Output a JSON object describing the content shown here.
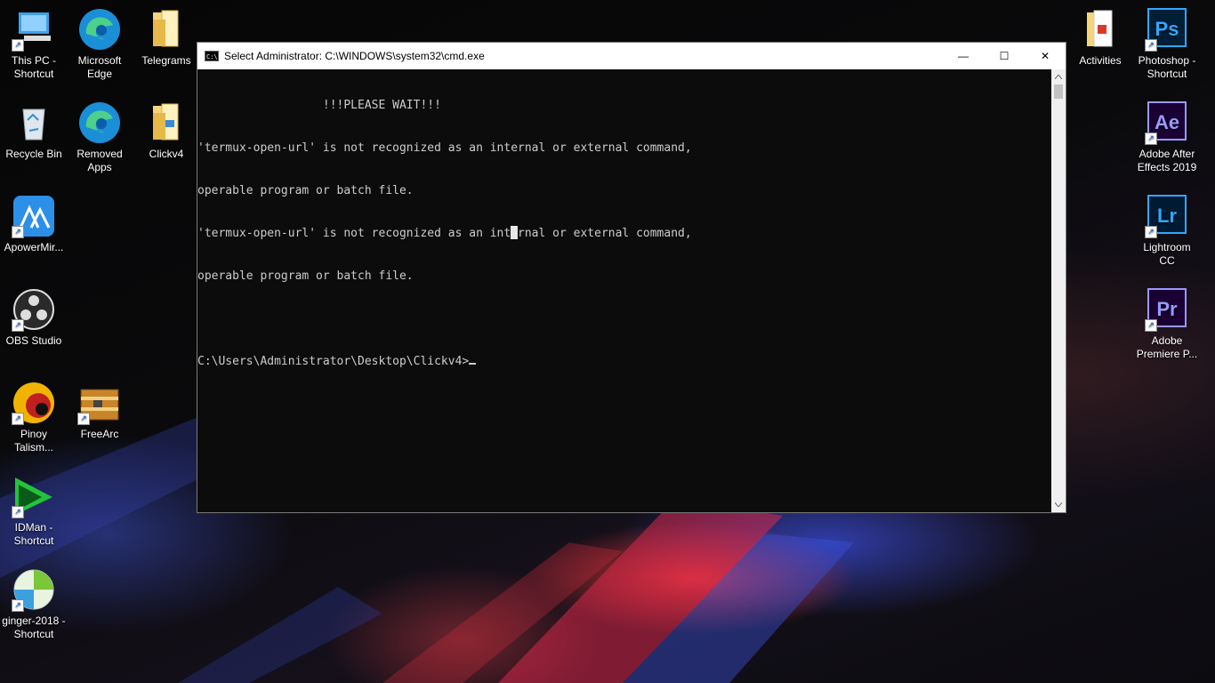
{
  "desktop": {
    "left_icons": [
      {
        "label": "This PC -\nShortcut",
        "icon": "this-pc-icon"
      },
      {
        "label": "Microsoft\nEdge",
        "icon": "edge-icon"
      },
      {
        "label": "Telegrams",
        "icon": "folder-icon"
      },
      {
        "label": "Recycle Bin",
        "icon": "recycle-bin-icon"
      },
      {
        "label": "Removed\nApps",
        "icon": "edge-icon"
      },
      {
        "label": "Clickv4",
        "icon": "folder-icon"
      },
      {
        "label": "ApowerMir...",
        "icon": "apowermirror-icon"
      },
      {
        "label": "OBS Studio",
        "icon": "obs-icon"
      },
      {
        "label": "Pinoy\nTalism...",
        "icon": "pinoy-talisman-icon"
      },
      {
        "label": "FreeArc",
        "icon": "freearc-icon"
      },
      {
        "label": "IDMan -\nShortcut",
        "icon": "idm-icon"
      },
      {
        "label": "ginger-2018 -\nShortcut",
        "icon": "ginger-icon"
      }
    ],
    "right_icons": [
      {
        "label": "Activities",
        "icon": "document-folder-icon"
      },
      {
        "label": "Photoshop -\nShortcut",
        "icon": "photoshop-icon",
        "abbr": "Ps"
      },
      {
        "label": "Adobe After\nEffects 2019",
        "icon": "after-effects-icon",
        "abbr": "Ae"
      },
      {
        "label": "Lightroom\nCC",
        "icon": "lightroom-icon",
        "abbr": "Lr"
      },
      {
        "label": "Adobe\nPremiere P...",
        "icon": "premiere-icon",
        "abbr": "Pr"
      }
    ]
  },
  "window": {
    "title": "Select Administrator: C:\\WINDOWS\\system32\\cmd.exe",
    "icon_text": "C:\\",
    "minimize": "—",
    "maximize": "☐",
    "close": "✕",
    "console_lines": [
      "                  !!!PLEASE WAIT!!!",
      "'termux-open-url' is not recognized as an internal or external command,",
      "operable program or batch file.",
      "'termux-open-url' is not recognized as an internal or external command,",
      "operable program or batch file.",
      "",
      "C:\\Users\\Administrator\\Desktop\\Clickv4>"
    ]
  },
  "colors": {
    "console_bg": "#0c0c0c",
    "console_text": "#cccccc",
    "ps": "#31a8ff",
    "ae": "#9999ff",
    "lr": "#31a8ff",
    "pr": "#9999ff"
  }
}
